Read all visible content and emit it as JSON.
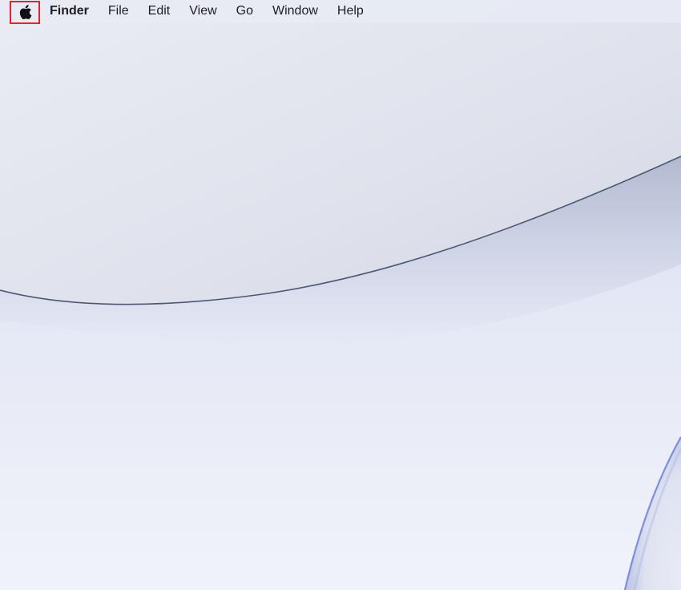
{
  "menubar": {
    "apple_menu_icon": "apple-logo-icon",
    "app_name": "Finder",
    "items": [
      {
        "label": "File"
      },
      {
        "label": "Edit"
      },
      {
        "label": "View"
      },
      {
        "label": "Go"
      },
      {
        "label": "Window"
      },
      {
        "label": "Help"
      }
    ],
    "highlight_color": "#e0242f"
  },
  "desktop": {
    "wallpaper_colors": {
      "upper": "#dfe2ec",
      "lower": "#eef1fa",
      "edge": "#4c5873",
      "glow": "#6f7fd6"
    }
  }
}
